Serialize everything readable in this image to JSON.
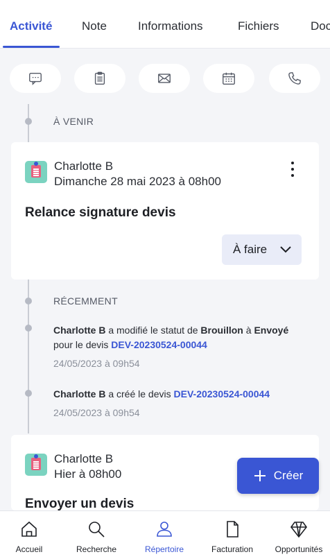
{
  "tabs": [
    {
      "label": "Activité",
      "active": true
    },
    {
      "label": "Note"
    },
    {
      "label": "Informations"
    },
    {
      "label": "Fichiers"
    },
    {
      "label": "Doc"
    }
  ],
  "quick_actions": [
    {
      "icon": "chat-icon"
    },
    {
      "icon": "clipboard-icon"
    },
    {
      "icon": "mail-icon"
    },
    {
      "icon": "calendar-icon"
    },
    {
      "icon": "phone-icon"
    }
  ],
  "upcoming": {
    "label": "À VENIR",
    "card": {
      "person": "Charlotte B",
      "when": "Dimanche 28 mai 2023 à 08h00",
      "title": "Relance signature devis",
      "status": "À faire"
    }
  },
  "recent": {
    "label": "RÉCEMMENT",
    "events": [
      {
        "actor": "Charlotte B",
        "text1": " a modifié le statut de ",
        "from": "Brouillon",
        "text2": " à ",
        "to": "Envoyé",
        "text3": " pour le devis ",
        "ref": "DEV-20230524-00044",
        "time": "24/05/2023 à 09h54"
      },
      {
        "actor": "Charlotte B",
        "text1": " a créé le devis ",
        "ref": "DEV-20230524-00044",
        "time": "24/05/2023 à 09h54"
      }
    ]
  },
  "next_card": {
    "person": "Charlotte B",
    "when": "Hier à 08h00",
    "title": "Envoyer un devis"
  },
  "fab": {
    "label": "Créer"
  },
  "bottom_nav": [
    {
      "label": "Accueil",
      "icon": "home-icon"
    },
    {
      "label": "Recherche",
      "icon": "search-icon"
    },
    {
      "label": "Répertoire",
      "icon": "contacts-icon",
      "active": true
    },
    {
      "label": "Facturation",
      "icon": "document-icon"
    },
    {
      "label": "Opportunités",
      "icon": "diamond-icon"
    }
  ],
  "colors": {
    "accent": "#3a56d4",
    "background": "#f4f5f8",
    "avatar": "#7bd3c0"
  }
}
